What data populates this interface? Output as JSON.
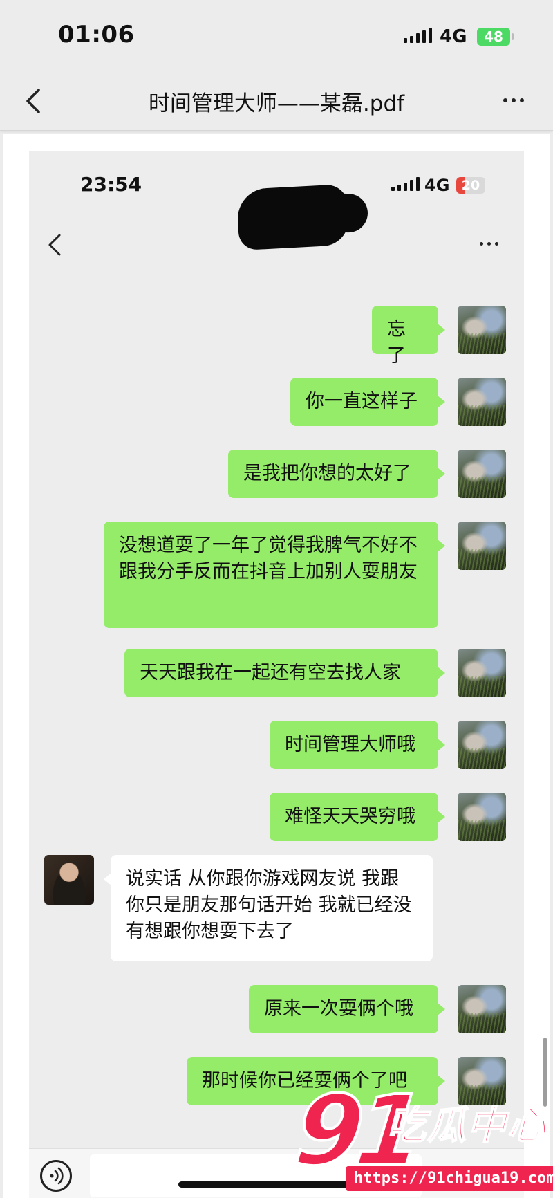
{
  "outer": {
    "status": {
      "time": "01:06",
      "network": "4G",
      "battery": "48"
    },
    "nav": {
      "title": "时间管理大师——某磊.pdf"
    },
    "colors": {
      "battery": "#4cd964"
    }
  },
  "inner": {
    "status": {
      "time": "23:54",
      "network": "4G",
      "battery": "20"
    },
    "colors": {
      "battery": "#e8473d",
      "bubble_out": "#95ec69",
      "bubble_in": "#ffffff"
    },
    "messages": [
      {
        "from": "me",
        "text": "忘了"
      },
      {
        "from": "me",
        "text": "你一直这样子"
      },
      {
        "from": "me",
        "text": "是我把你想的太好了"
      },
      {
        "from": "me",
        "text": "没想道耍了一年了觉得我脾气不好不跟我分手反而在抖音上加别人耍朋友"
      },
      {
        "from": "me",
        "text": "天天跟我在一起还有空去找人家"
      },
      {
        "from": "me",
        "text": "时间管理大师哦"
      },
      {
        "from": "me",
        "text": "难怪天天哭穷哦"
      },
      {
        "from": "other",
        "text": "说实话 从你跟你游戏网友说 我跟你只是朋友那句话开始 我就已经没有想跟你想耍下去了"
      },
      {
        "from": "me",
        "text": "原来一次耍俩个哦"
      },
      {
        "from": "me",
        "text": "那时候你已经耍俩个了吧"
      }
    ]
  },
  "watermark": {
    "number": "91",
    "text": "吃瓜中心",
    "url": "https://91chigua19.com"
  }
}
